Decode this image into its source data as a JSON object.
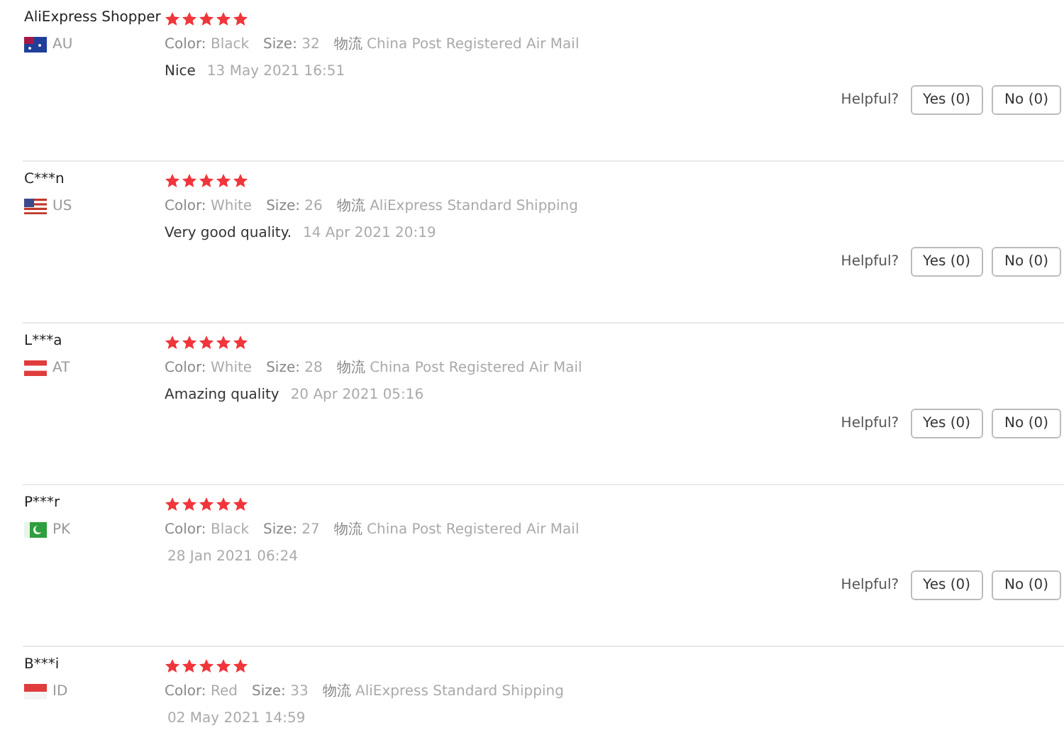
{
  "reviews": [
    {
      "name": "AliExpress Shopper",
      "country": "AU",
      "kind": "au",
      "stars": 5,
      "specs": [
        {
          "label": "Color:",
          "value": "Black"
        },
        {
          "label": "Size:",
          "value": "32"
        },
        {
          "label": "物流",
          "value": "China Post Registered Air Mail"
        }
      ],
      "text": "Nice",
      "date": "13 May 2021 16:51",
      "helpful": {
        "label": "Helpful?",
        "yes": "Yes (0)",
        "no": "No (0)"
      }
    },
    {
      "name": "C***n",
      "country": "US",
      "kind": "us",
      "stars": 5,
      "specs": [
        {
          "label": "Color:",
          "value": "White"
        },
        {
          "label": "Size:",
          "value": "26"
        },
        {
          "label": "物流",
          "value": "AliExpress Standard Shipping"
        }
      ],
      "text": "Very good quality.",
      "date": "14 Apr 2021 20:19",
      "helpful": {
        "label": "Helpful?",
        "yes": "Yes (0)",
        "no": "No (0)"
      }
    },
    {
      "name": "L***a",
      "country": "AT",
      "kind": "at",
      "stars": 5,
      "specs": [
        {
          "label": "Color:",
          "value": "White"
        },
        {
          "label": "Size:",
          "value": "28"
        },
        {
          "label": "物流",
          "value": "China Post Registered Air Mail"
        }
      ],
      "text": "Amazing quality",
      "date": "20 Apr 2021 05:16",
      "helpful": {
        "label": "Helpful?",
        "yes": "Yes (0)",
        "no": "No (0)"
      }
    },
    {
      "name": "P***r",
      "country": "PK",
      "kind": "pk",
      "stars": 5,
      "specs": [
        {
          "label": "Color:",
          "value": "Black"
        },
        {
          "label": "Size:",
          "value": "27"
        },
        {
          "label": "物流",
          "value": "China Post Registered Air Mail"
        }
      ],
      "date": "28 Jan 2021 06:24",
      "helpful": {
        "label": "Helpful?",
        "yes": "Yes (0)",
        "no": "No (0)"
      }
    },
    {
      "name": "B***i",
      "country": "ID",
      "kind": "id",
      "stars": 5,
      "specs": [
        {
          "label": "Color:",
          "value": "Red"
        },
        {
          "label": "Size:",
          "value": "33"
        },
        {
          "label": "物流",
          "value": "AliExpress Standard Shipping"
        }
      ],
      "date": "02 May 2021 14:59"
    }
  ]
}
